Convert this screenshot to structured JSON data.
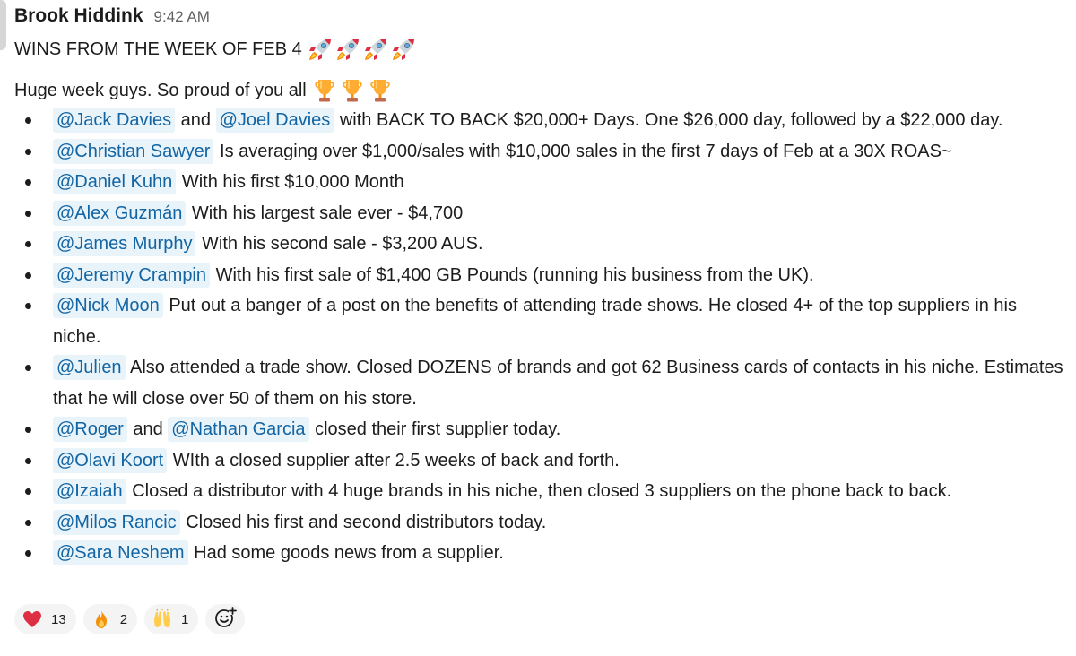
{
  "message": {
    "author": "Brook Hiddink",
    "time": "9:42 AM",
    "headline": "WINS FROM THE WEEK OF FEB 4",
    "headline_emoji": "rocket-icon",
    "intro": "Huge week guys. So proud of you all",
    "intro_emoji": "trophy-icon",
    "items": [
      {
        "m1": "@Jack Davies",
        "t1": " and ",
        "m2": "@Joel Davies",
        "t2": " with BACK TO BACK $20,000+ Days. One $26,000 day, followed by a $22,000 day."
      },
      {
        "m1": "@Christian Sawyer",
        "t1": " Is averaging over $1,000/sales with $10,000 sales in the first 7 days of Feb at a 30X ROAS~"
      },
      {
        "m1": "@Daniel Kuhn",
        "t1": " With his first $10,000 Month"
      },
      {
        "m1": "@Alex Guzmán",
        "t1": " With his largest sale ever - $4,700"
      },
      {
        "m1": "@James Murphy",
        "t1": " With his second sale - $3,200 AUS."
      },
      {
        "m1": "@Jeremy Crampin",
        "t1": " With his first sale of $1,400 GB Pounds (running his business from the UK)."
      },
      {
        "m1": "@Nick Moon",
        "t1": " Put out a banger of a post on the benefits of attending trade shows. He closed 4+ of the top suppliers in his niche."
      },
      {
        "m1": "@Julien",
        "t1": " Also attended a trade show. Closed DOZENS of brands and got 62 Business cards of contacts in his niche. Estimates that he will close over 50 of them on his store."
      },
      {
        "m1": "@Roger",
        "t1": " and ",
        "m2": "@Nathan Garcia",
        "t2": " closed their first supplier today."
      },
      {
        "m1": "@Olavi Koort",
        "t1": " WIth a closed supplier after 2.5 weeks of back and forth."
      },
      {
        "m1": "@Izaiah",
        "t1": " Closed a distributor with 4 huge brands in his niche, then closed 3 suppliers on the phone back to back."
      },
      {
        "m1": "@Milos Rancic",
        "t1": " Closed his first and second distributors today."
      },
      {
        "m1": "@Sara Neshem",
        "t1": " Had some goods news from a supplier."
      }
    ]
  },
  "reactions": [
    {
      "icon": "heart-icon",
      "count": "13"
    },
    {
      "icon": "fire-icon",
      "count": "2"
    },
    {
      "icon": "raised-hands-icon",
      "count": "1"
    }
  ],
  "add_reaction_icon": "add-reaction-icon",
  "colors": {
    "mention_bg": "#e8f3fa",
    "mention_text": "#1264a3",
    "text": "#1d1c1d",
    "muted": "#616061",
    "reaction_bg": "#f4f4f4"
  }
}
